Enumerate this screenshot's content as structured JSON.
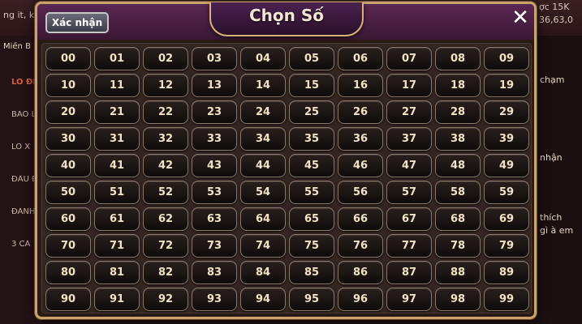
{
  "background": {
    "top_left_text": "ng it, k",
    "top_right_line1": "ợc 15K",
    "top_right_line2": "36,63,0",
    "region_label": "Miền B",
    "side_items": [
      "LÔ ĐỀ",
      "BAO L",
      "LÔ X",
      "ĐẦU Đ",
      "ĐÁNH",
      "3 CÀ"
    ],
    "right_texts": [
      "chạm",
      "nhận",
      "thích",
      "gì à em"
    ]
  },
  "modal": {
    "title": "Chọn Số",
    "confirm_label": "Xác nhận",
    "close_label": "✕",
    "numbers": [
      "00",
      "01",
      "02",
      "03",
      "04",
      "05",
      "06",
      "07",
      "08",
      "09",
      "10",
      "11",
      "12",
      "13",
      "14",
      "15",
      "16",
      "17",
      "18",
      "19",
      "20",
      "21",
      "22",
      "23",
      "24",
      "25",
      "26",
      "27",
      "28",
      "29",
      "30",
      "31",
      "32",
      "33",
      "34",
      "35",
      "36",
      "37",
      "38",
      "39",
      "40",
      "41",
      "42",
      "43",
      "44",
      "45",
      "46",
      "47",
      "48",
      "49",
      "50",
      "51",
      "52",
      "53",
      "54",
      "55",
      "56",
      "57",
      "58",
      "59",
      "60",
      "61",
      "62",
      "63",
      "64",
      "65",
      "66",
      "67",
      "68",
      "69",
      "70",
      "71",
      "72",
      "73",
      "74",
      "75",
      "76",
      "77",
      "78",
      "79",
      "80",
      "81",
      "82",
      "83",
      "84",
      "85",
      "86",
      "87",
      "88",
      "89",
      "90",
      "91",
      "92",
      "93",
      "94",
      "95",
      "96",
      "97",
      "98",
      "99"
    ]
  },
  "colors": {
    "number_text": "#f2e2c6",
    "frame_gold": "#c9a36b",
    "header_purple": "#4b2250"
  }
}
